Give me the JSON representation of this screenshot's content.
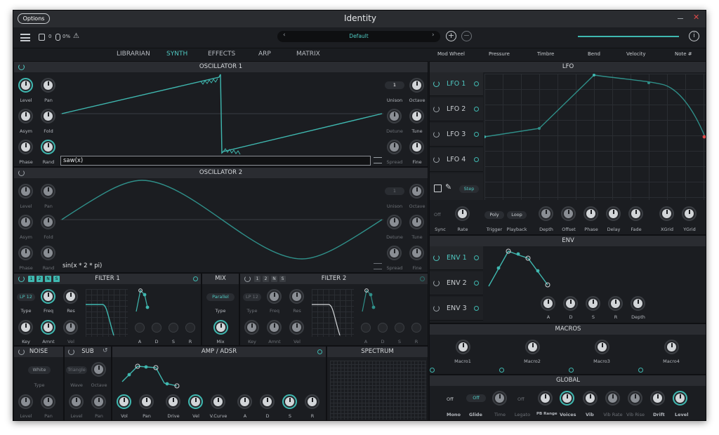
{
  "window": {
    "title": "Identity",
    "options_label": "Options"
  },
  "toolbar": {
    "cpu_count": "0",
    "cpu_pct": "0%",
    "preset": "Default"
  },
  "tabs": [
    "LIBRARIAN",
    "SYNTH",
    "EFFECTS",
    "ARP",
    "MATRIX"
  ],
  "active_tab": "SYNTH",
  "mod_sources": [
    "Mod Wheel",
    "Pressure",
    "Timbre",
    "Bend",
    "Velocity",
    "Note #"
  ],
  "osc1": {
    "title": "OSCILLATOR 1",
    "unison": "1",
    "expression": "saw(x)",
    "labels": {
      "level": "Level",
      "pan": "Pan",
      "asym": "Asym",
      "fold": "Fold",
      "phase": "Phase",
      "rand": "Rand",
      "unison": "Unison",
      "octave": "Octave",
      "detune": "Detune",
      "tune": "Tune",
      "spread": "Spread",
      "fine": "Fine"
    }
  },
  "osc2": {
    "title": "OSCILLATOR 2",
    "unison": "1",
    "expression": "sin(x * 2 * pi)",
    "labels": {
      "level": "Level",
      "pan": "Pan",
      "asym": "Asym",
      "fold": "Fold",
      "phase": "Phase",
      "rand": "Rand",
      "unison": "Unison",
      "octave": "Octave",
      "detune": "Detune",
      "tune": "Tune",
      "spread": "Spread",
      "fine": "Fine"
    }
  },
  "filter1": {
    "title": "FILTER 1",
    "type": "LP 12",
    "labels": [
      "Type",
      "Freq",
      "Res",
      "Key",
      "Amnt",
      "Vel"
    ],
    "adsr": [
      "A",
      "D",
      "S",
      "R"
    ],
    "routes": [
      "1",
      "2",
      "N",
      "S"
    ]
  },
  "mix": {
    "title": "MIX",
    "type": "Parallel",
    "labels": [
      "Type",
      "Mix"
    ]
  },
  "filter2": {
    "title": "FILTER 2",
    "type": "LP 12",
    "labels": [
      "Type",
      "Freq",
      "Res",
      "Key",
      "Amnt",
      "Vel"
    ],
    "adsr": [
      "A",
      "D",
      "S",
      "R"
    ],
    "routes": [
      "1",
      "2",
      "N",
      "S"
    ]
  },
  "noise": {
    "title": "NOISE",
    "type": "White",
    "labels": [
      "Type",
      "Level",
      "Pan"
    ]
  },
  "sub": {
    "title": "SUB",
    "wave": "Triangle",
    "labels": [
      "Wave",
      "Octave",
      "Level",
      "Pan"
    ]
  },
  "amp": {
    "title": "AMP / ADSR",
    "labels": [
      "Vol",
      "Pan",
      "Drive",
      "Vel",
      "V.Curve",
      "A",
      "D",
      "S",
      "R"
    ]
  },
  "spectrum": {
    "title": "SPECTRUM"
  },
  "lfo": {
    "title": "LFO",
    "items": [
      "LFO 1",
      "LFO 2",
      "LFO 3",
      "LFO 4"
    ],
    "step": "Step",
    "sync": "Off",
    "poly": "Poly",
    "loop": "Loop",
    "labels": [
      "Sync",
      "Rate",
      "Trigger",
      "Playback",
      "Depth",
      "Offset",
      "Phase",
      "Delay",
      "Fade",
      "XGrid",
      "YGrid"
    ]
  },
  "env": {
    "title": "ENV",
    "items": [
      "ENV 1",
      "ENV 2",
      "ENV 3"
    ],
    "labels": [
      "A",
      "D",
      "S",
      "R",
      "Depth"
    ]
  },
  "macros": {
    "title": "MACROS",
    "items": [
      "Macro1",
      "Macro2",
      "Macro3",
      "Macro4"
    ]
  },
  "global": {
    "title": "GLOBAL",
    "mono": "Off",
    "glide": "Off",
    "legato": "Off",
    "labels": [
      "Mono",
      "Glide",
      "Time",
      "Legato",
      "PB Range",
      "Voices",
      "Vib",
      "Vib Rate",
      "Vib Rise",
      "Drift",
      "Level"
    ]
  },
  "colors": {
    "accent": "#3fb8b0",
    "panel": "#1b1d21",
    "header": "#2a2c31"
  }
}
